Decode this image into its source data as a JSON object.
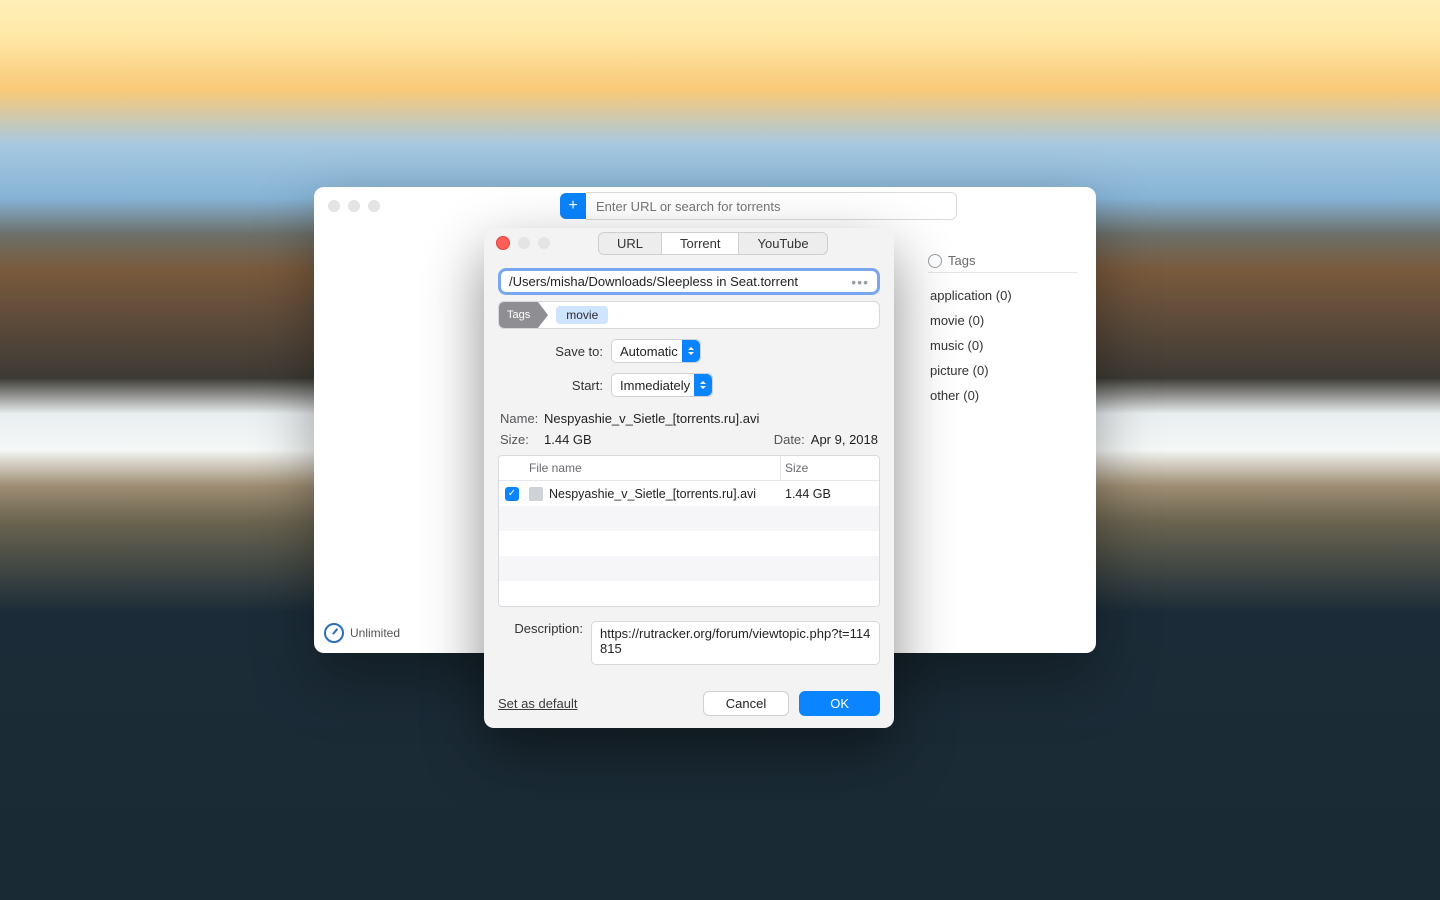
{
  "main": {
    "search_placeholder": "Enter URL or search for torrents",
    "status": "Unlimited",
    "tags_header": "Tags",
    "tags": [
      "application (0)",
      "movie (0)",
      "music (0)",
      "picture (0)",
      "other (0)"
    ]
  },
  "sheet": {
    "tabs": {
      "url": "URL",
      "torrent": "Torrent",
      "youtube": "YouTube"
    },
    "path": "/Users/misha/Downloads/Sleepless in Seat.torrent",
    "tags_label": "Tags",
    "tag_value": "movie",
    "save_to_label": "Save to:",
    "save_to_value": "Automatic",
    "start_label": "Start:",
    "start_value": "Immediately",
    "name_label": "Name:",
    "name_value": "Nespyashie_v_Sietle_[torrents.ru].avi",
    "size_label": "Size:",
    "size_value": "1.44 GB",
    "date_label": "Date:",
    "date_value": "Apr 9, 2018",
    "table": {
      "head_file": "File name",
      "head_size": "Size",
      "rows": [
        {
          "checked": true,
          "name": "Nespyashie_v_Sietle_[torrents.ru].avi",
          "size": "1.44 GB"
        }
      ]
    },
    "desc_label": "Description:",
    "desc_value": "https://rutracker.org/forum/viewtopic.php?t=114815",
    "set_default": "Set as default",
    "cancel": "Cancel",
    "ok": "OK"
  }
}
